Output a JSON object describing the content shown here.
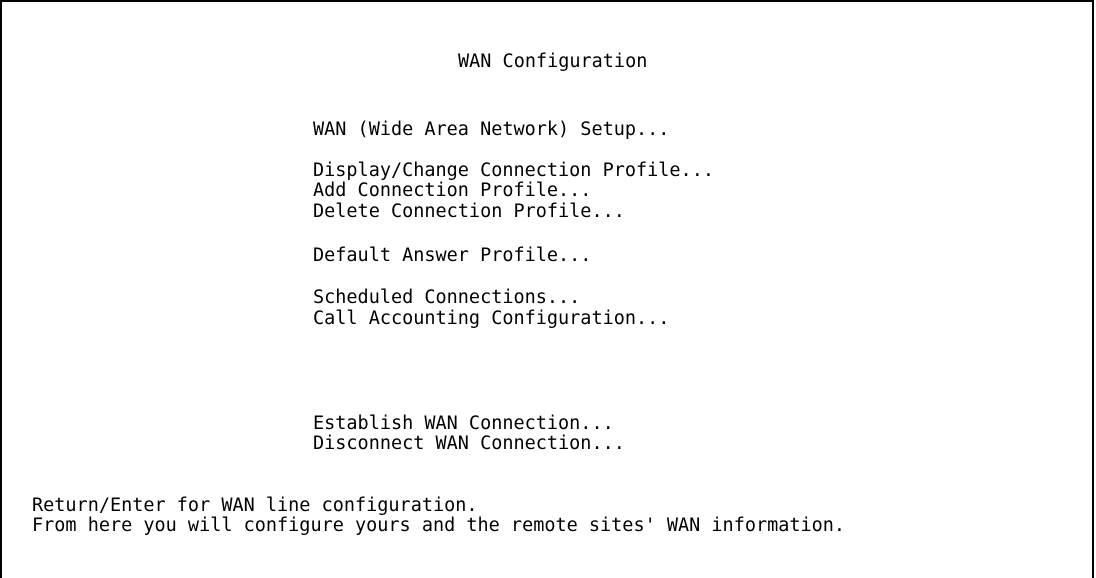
{
  "screen": {
    "title": "WAN Configuration",
    "menu": {
      "wan_setup": "WAN (Wide Area Network) Setup...",
      "display_change_profile": "Display/Change Connection Profile...",
      "add_profile": "Add Connection Profile...",
      "delete_profile": "Delete Connection Profile...",
      "default_answer_profile": "Default Answer Profile...",
      "scheduled_connections": "Scheduled Connections...",
      "call_accounting": "Call Accounting Configuration...",
      "establish_connection": "Establish WAN Connection...",
      "disconnect_connection": "Disconnect WAN Connection..."
    },
    "help": {
      "line1": "Return/Enter for WAN line configuration.",
      "line2": "From here you will configure yours and the remote sites' WAN information."
    }
  }
}
